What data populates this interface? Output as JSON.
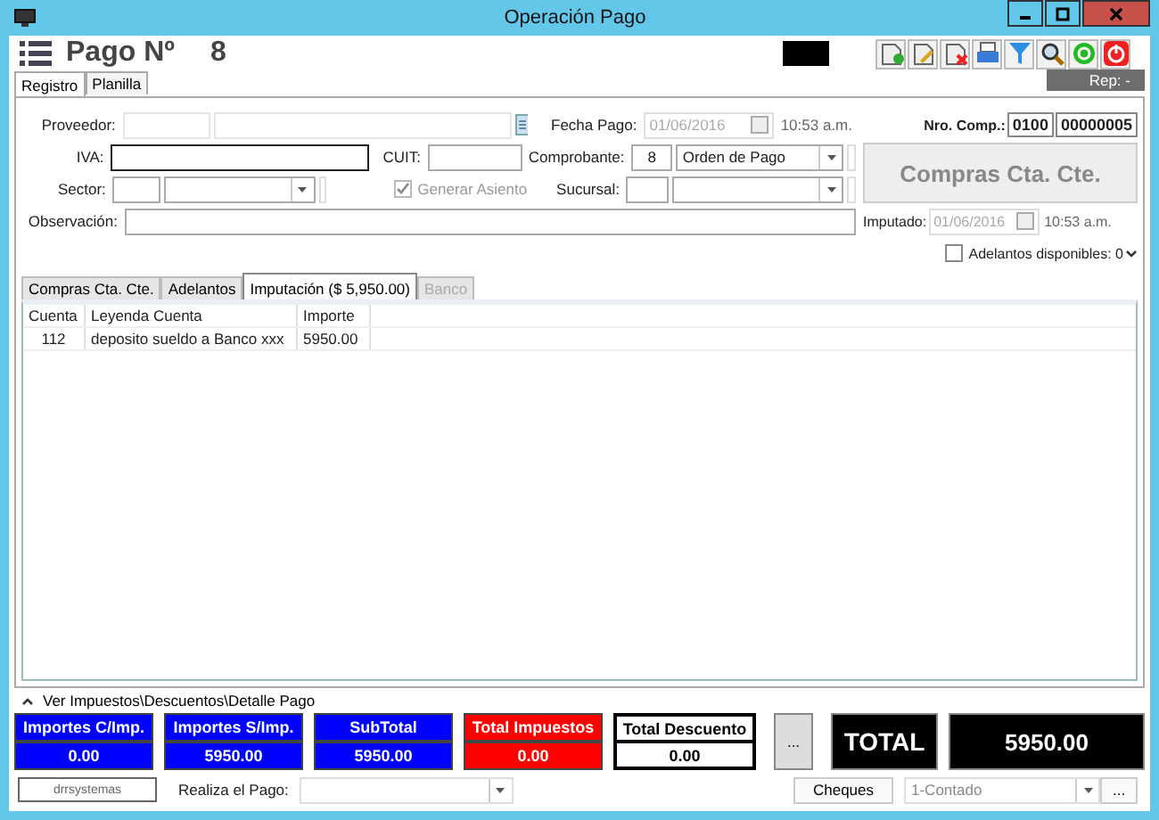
{
  "window": {
    "title": "Operación Pago"
  },
  "header": {
    "title": "Pago Nº",
    "number": "8",
    "rep": "Rep: -"
  },
  "main_tabs": [
    {
      "label": "Registro",
      "selected": true
    },
    {
      "label": "Planilla",
      "selected": false
    }
  ],
  "form": {
    "proveedor_label": "Proveedor:",
    "iva_label": "IVA:",
    "cuit_label": "CUIT:",
    "sector_label": "Sector:",
    "generar_asiento": {
      "label": "Generar Asiento",
      "checked": true,
      "disabled": true
    },
    "observacion_label": "Observación:",
    "fecha_pago_label": "Fecha Pago:",
    "fecha_pago": "01/06/2016",
    "fecha_pago_time": "10:53 a.m.",
    "comprobante_label": "Comprobante:",
    "comprobante_code": "8",
    "comprobante_type": "Orden de Pago",
    "sucursal_label": "Sucursal:",
    "nro_comp_label": "Nro. Comp.:",
    "nro_comp_prefix": "0100",
    "nro_comp_number": "00000005",
    "mode_button": "Compras Cta. Cte.",
    "imputado_label": "Imputado:",
    "imputado_date": "01/06/2016",
    "imputado_time": "10:53 a.m.",
    "adelantos": {
      "label": "Adelantos disponibles: 0",
      "checked": false
    }
  },
  "sub_tabs": [
    {
      "label": "Compras Cta. Cte.",
      "selected": false,
      "disabled": false
    },
    {
      "label": "Adelantos",
      "selected": false,
      "disabled": false
    },
    {
      "label": "Imputación ($ 5,950.00)",
      "selected": true,
      "disabled": false
    },
    {
      "label": "Banco",
      "selected": false,
      "disabled": true
    }
  ],
  "table": {
    "columns": [
      "Cuenta",
      "Leyenda Cuenta",
      "Importe"
    ],
    "rows": [
      [
        "112",
        "deposito sueldo a Banco xxx",
        "5950.00"
      ]
    ]
  },
  "footer": {
    "expander": {
      "label": "Ver Impuestos\\Descuentos\\Detalle Pago",
      "expanded": true
    },
    "totals": [
      {
        "label": "Importes C/Imp.",
        "value": "0.00",
        "kind": "amount"
      },
      {
        "label": "Importes S/Imp.",
        "value": "5950.00",
        "kind": "amount"
      },
      {
        "label": "SubTotal",
        "value": "5950.00",
        "kind": "amount"
      },
      {
        "label": "Total Impuestos",
        "value": "0.00",
        "kind": "tax"
      },
      {
        "label": "Total Descuento",
        "value": "0.00",
        "kind": "discount"
      }
    ],
    "more_button": "...",
    "total_label": "TOTAL",
    "total_value": "5950.00"
  },
  "bottom": {
    "brand_button": "drrsystemas",
    "payer_label": "Realiza el Pago:",
    "cheques_button": "Cheques",
    "payment_method": "1-Contado",
    "ellipsis_button": "..."
  }
}
